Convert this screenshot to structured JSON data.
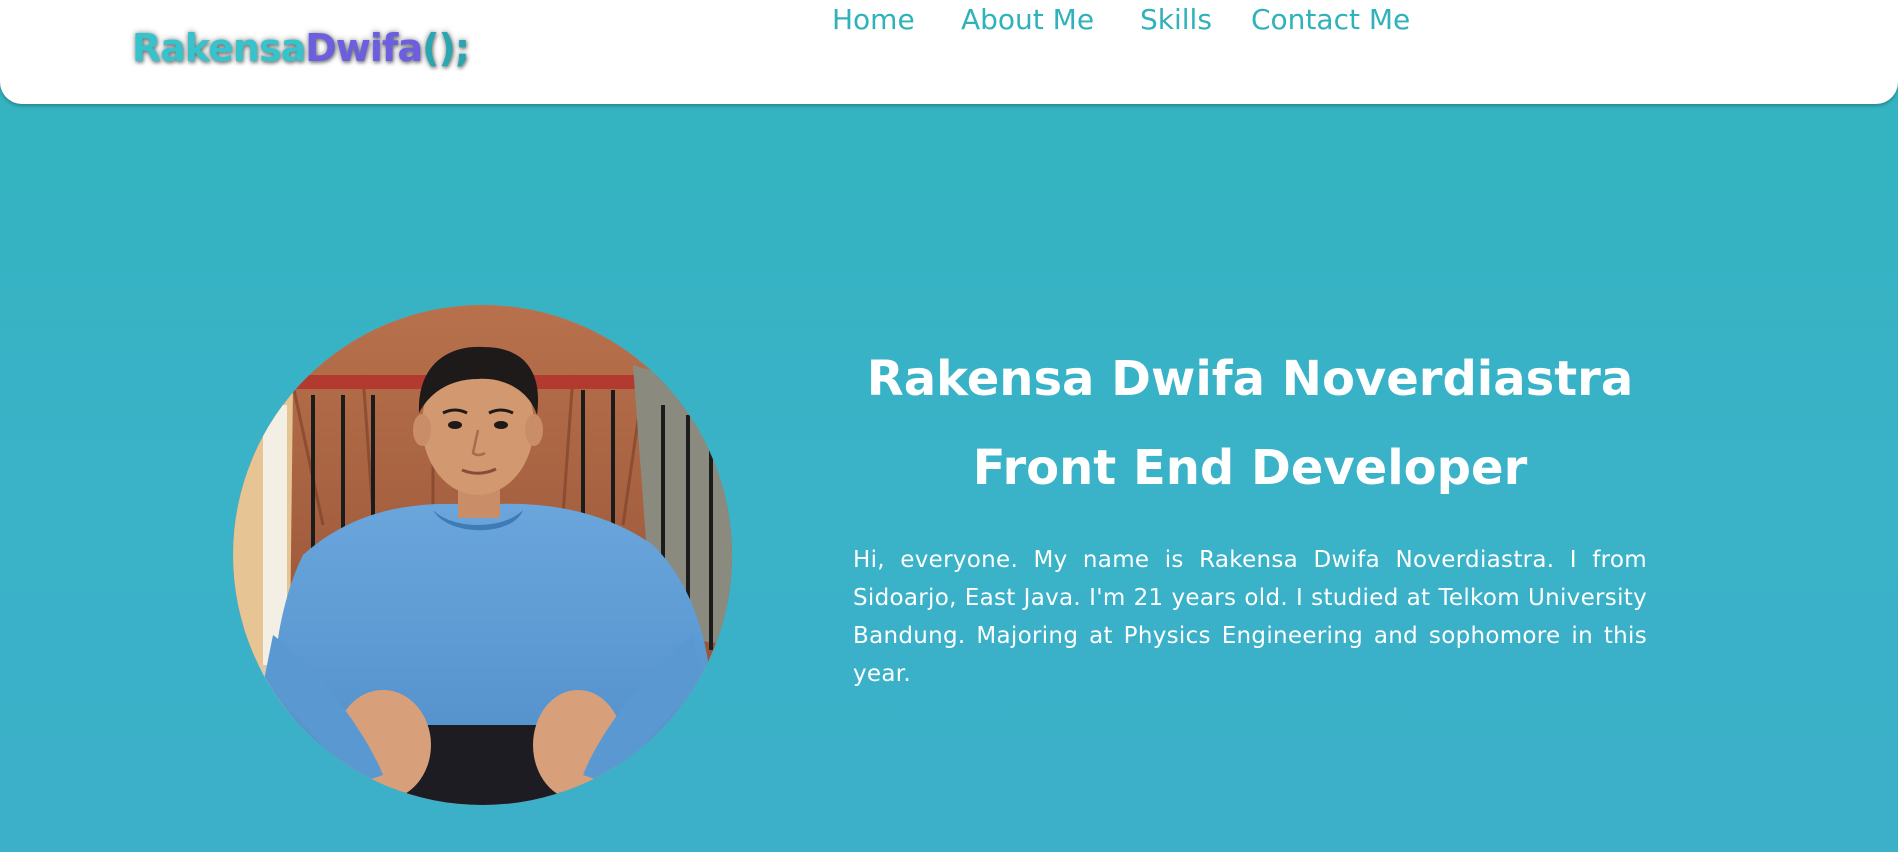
{
  "brand": {
    "part1": "Rakensa",
    "part2": "Dwifa",
    "part3": "();"
  },
  "nav": {
    "items": [
      {
        "label": "Home"
      },
      {
        "label": "About Me"
      },
      {
        "label": "Skills"
      },
      {
        "label": "Contact Me"
      }
    ]
  },
  "hero": {
    "name": "Rakensa Dwifa Noverdiastra",
    "role": "Front End Developer",
    "bio": "Hi, everyone. My name is Rakensa Dwifa Noverdiastra. I from Sidoarjo, East Java. I'm 21 years old. I studied at Telkom University Bandung. Majoring at Physics Engineering and sophomore in this year.",
    "photo_icon": "profile-photo"
  },
  "colors": {
    "accent": "#2fb2ba",
    "background_top": "#31b4bd",
    "background_bottom": "#3bb0c8",
    "brand_purple": "#6b5fe0",
    "header_bg": "#ffffff",
    "text_light": "#ffffff"
  }
}
